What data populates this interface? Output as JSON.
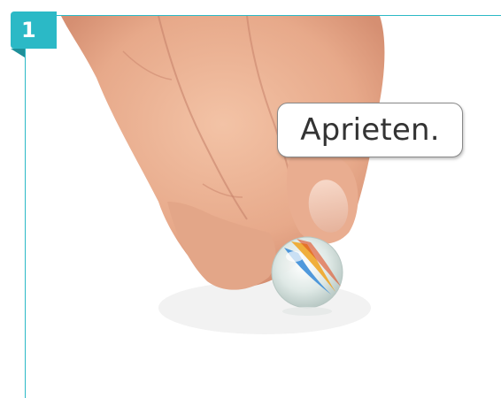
{
  "badge": {
    "number": "1"
  },
  "bubble": {
    "text": "Aprieten."
  },
  "colors": {
    "accent": "#2bb9c6"
  },
  "image": {
    "subject": "hand-holding-marble-photo"
  }
}
